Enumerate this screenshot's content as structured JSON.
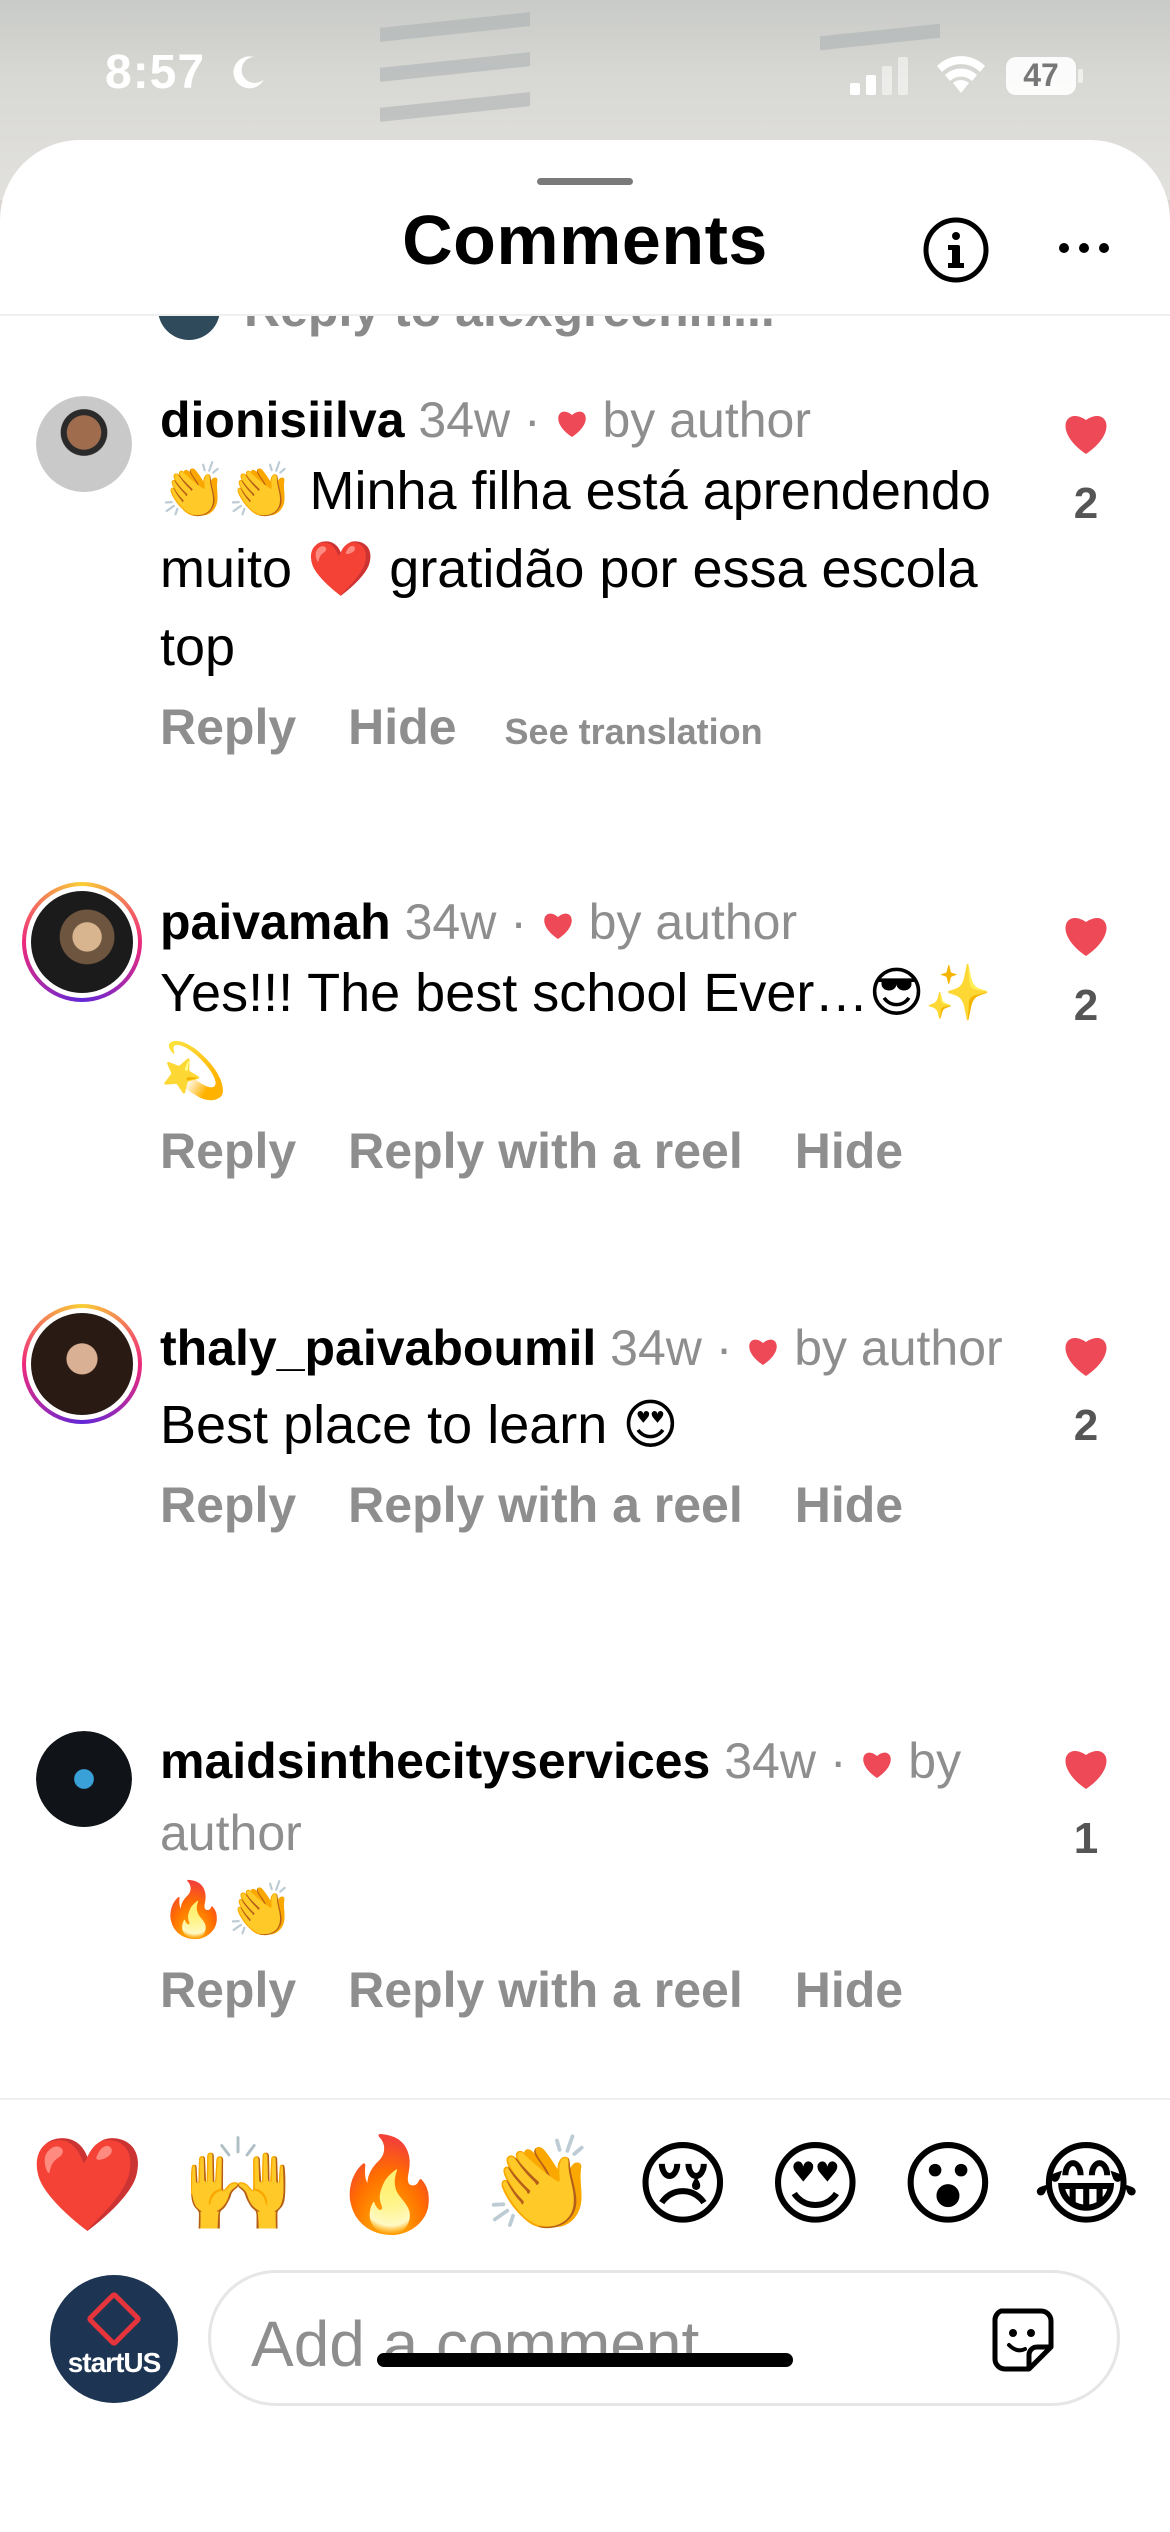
{
  "status_bar": {
    "time": "8:57",
    "battery": "47"
  },
  "header": {
    "title": "Comments"
  },
  "partial_reply_text": "Reply to alexgreenm...",
  "comments": [
    {
      "username": "dionisiilva",
      "age": "34w",
      "liked_by": "by author",
      "text": "👏👏 Minha filha está aprendendo muito ❤️ gratidão por essa escola top",
      "actions": [
        "Reply",
        "Hide"
      ],
      "extra_action": "See translation",
      "likes": "2"
    },
    {
      "username": "paivamah",
      "age": "34w",
      "liked_by": "by author",
      "text": "Yes!!! The best school Ever…😎✨💫",
      "actions": [
        "Reply",
        "Reply with a reel",
        "Hide"
      ],
      "likes": "2"
    },
    {
      "username": "thaly_paivaboumil",
      "age": "34w",
      "liked_by": "by author",
      "text": "Best place to learn 😍",
      "actions": [
        "Reply",
        "Reply with a reel",
        "Hide"
      ],
      "likes": "2"
    },
    {
      "username": "maidsinthecityservices",
      "age": "34w",
      "liked_by": "by author",
      "text": "🔥👏",
      "actions": [
        "Reply",
        "Reply with a reel",
        "Hide"
      ],
      "likes": "1"
    }
  ],
  "quick_reactions": [
    "❤️",
    "🙌",
    "🔥",
    "👏",
    "😢",
    "😍",
    "😮",
    "😂"
  ],
  "composer": {
    "placeholder": "Add a comment…",
    "avatar_text": "startUS"
  },
  "colors": {
    "like_red": "#ed4956",
    "muted_text": "#8e8e8e"
  }
}
